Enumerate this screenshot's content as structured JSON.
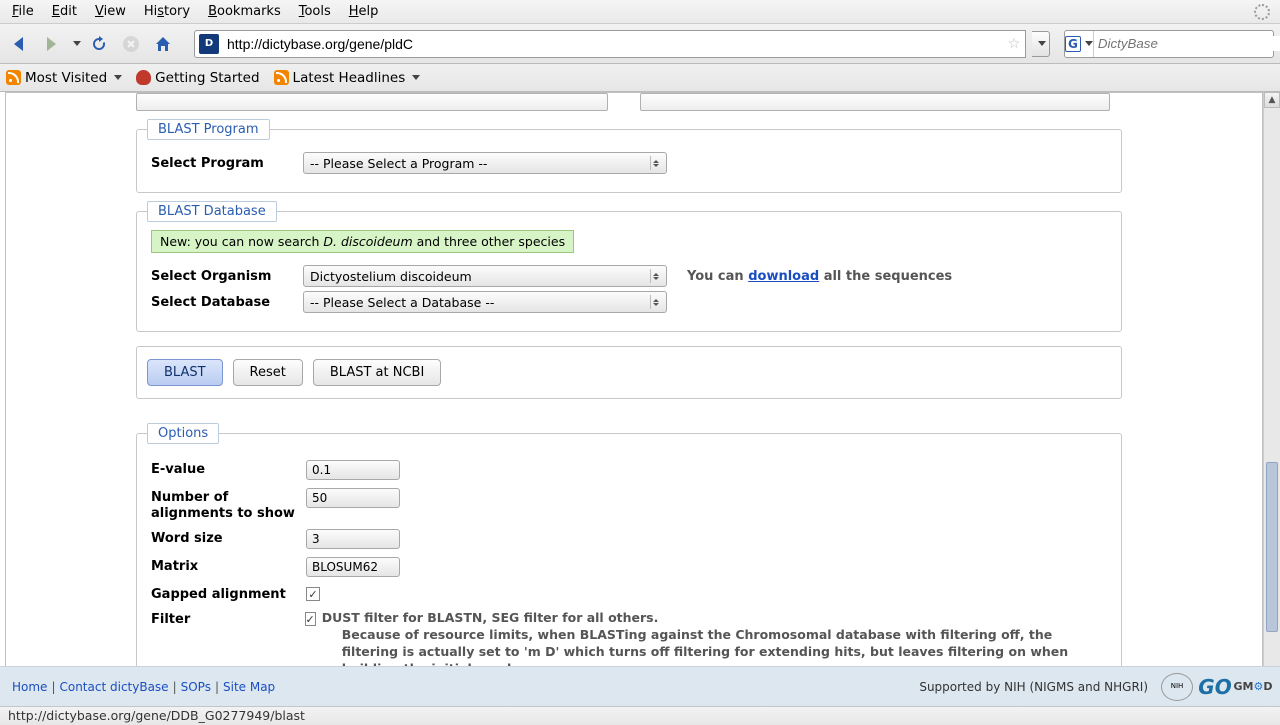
{
  "menubar": [
    "File",
    "Edit",
    "View",
    "History",
    "Bookmarks",
    "Tools",
    "Help"
  ],
  "toolbar": {
    "url": "http://dictybase.org/gene/pldC",
    "search_placeholder": "DictyBase"
  },
  "bookmarks_bar": {
    "most_visited": "Most Visited",
    "getting_started": "Getting Started",
    "latest_headlines": "Latest Headlines"
  },
  "blast_program": {
    "legend": "BLAST Program",
    "label": "Select Program",
    "value": "-- Please Select a Program --"
  },
  "blast_database": {
    "legend": "BLAST Database",
    "new_note_pre": "New: you can now search ",
    "new_note_em": "D. discoideum",
    "new_note_post": " and three other species",
    "organism_label": "Select Organism",
    "organism_value": "Dictyostelium discoideum",
    "database_label": "Select Database",
    "database_value": "-- Please Select a Database --",
    "download_pre": "You can ",
    "download_link": "download",
    "download_post": " all the sequences"
  },
  "buttons": {
    "blast": "BLAST",
    "reset": "Reset",
    "ncbi": "BLAST at NCBI"
  },
  "options": {
    "legend": "Options",
    "evalue_label": "E-value",
    "evalue_value": "0.1",
    "nalign_label": "Number of alignments to show",
    "nalign_value": "50",
    "wordsize_label": "Word size",
    "wordsize_value": "3",
    "matrix_label": "Matrix",
    "matrix_value": "BLOSUM62",
    "gapped_label": "Gapped alignment",
    "gapped_checked": "✓",
    "filter_label": "Filter",
    "filter_checked": "✓",
    "filter_text1": "DUST filter for BLASTN, SEG filter for all others.",
    "filter_text2": "Because of resource limits, when BLASTing against the Chromosomal database with filtering off, the filtering is actually set to 'm D' which turns off filtering for extending hits, but leaves filtering on when building the initial words."
  },
  "footer": {
    "home": "Home",
    "contact": "Contact dictyBase",
    "sops": "SOPs",
    "sitemap": "Site Map",
    "supported": "Supported by NIH (NIGMS and NHGRI)"
  },
  "status_url": "http://dictybase.org/gene/DDB_G0277949/blast"
}
